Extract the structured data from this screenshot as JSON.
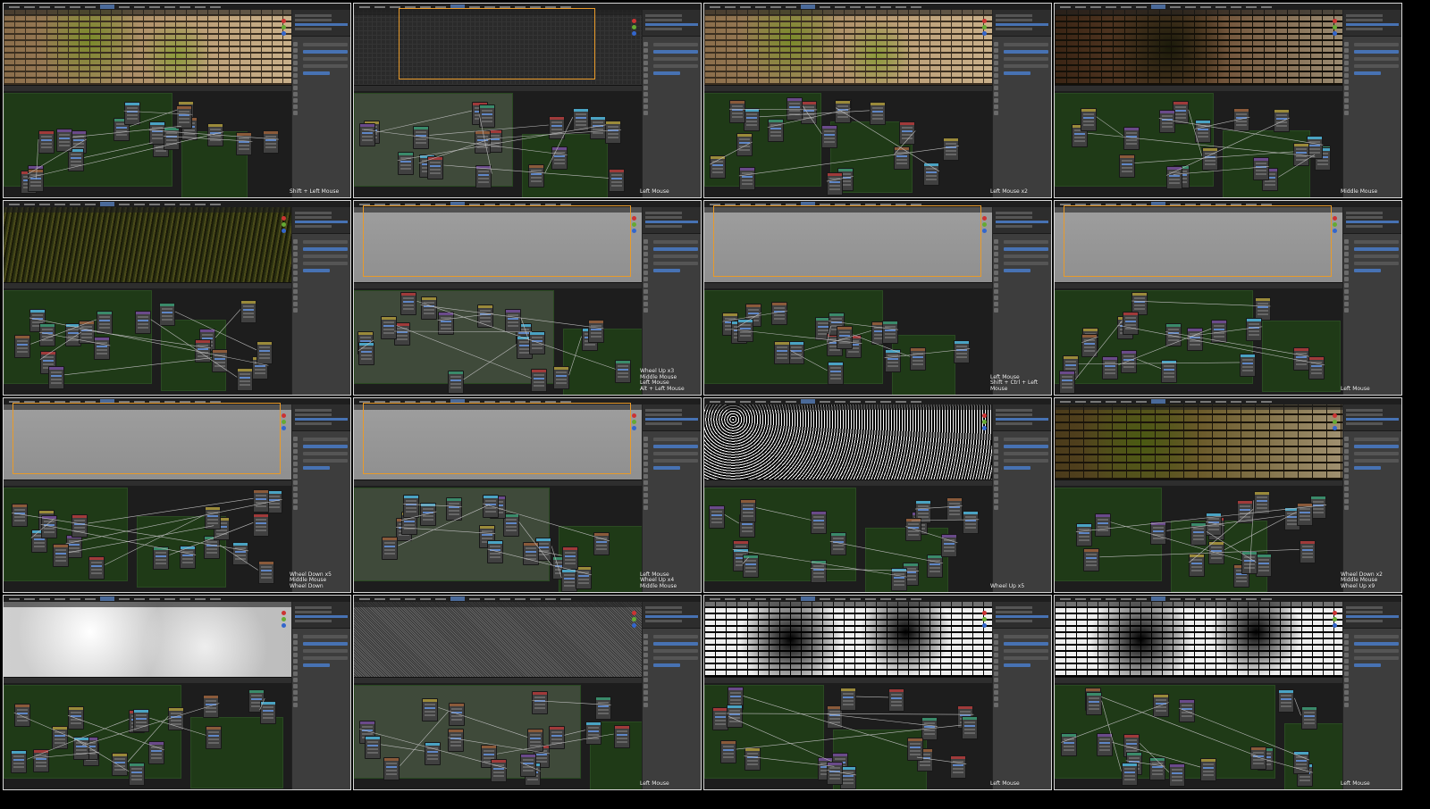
{
  "sheet_title": "Blender Shader Editor session - 16 frame contact sheet",
  "colors": {
    "accent_select": "#4772b3",
    "frame_green": "#1f3a17",
    "outline_orange": "#e89a2a"
  },
  "frames": [
    {
      "viewport": "vp-moss",
      "caption": [
        "Shift + Left Mouse"
      ]
    },
    {
      "viewport": "vp-gridplane",
      "caption": [
        "Left Mouse"
      ]
    },
    {
      "viewport": "vp-moss",
      "caption": [
        "Left Mouse x2"
      ]
    },
    {
      "viewport": "vp-darkbrick",
      "caption": [
        "Middle Mouse"
      ]
    },
    {
      "viewport": "vp-grass",
      "caption": []
    },
    {
      "viewport": "vp-gray",
      "caption": [
        "Wheel Up x3",
        "Middle Mouse",
        "Left Mouse",
        "Alt + Left Mouse"
      ]
    },
    {
      "viewport": "vp-gray",
      "caption": [
        "Left Mouse",
        "Shift + Ctrl + Left Mouse"
      ]
    },
    {
      "viewport": "vp-gray",
      "caption": [
        "Left Mouse"
      ]
    },
    {
      "viewport": "vp-gray",
      "caption": [
        "Wheel Down x5",
        "Middle Mouse",
        "Wheel Down"
      ]
    },
    {
      "viewport": "vp-gray",
      "caption": [
        "Left Mouse",
        "Wheel Up x4",
        "Middle Mouse"
      ]
    },
    {
      "viewport": "vp-noise",
      "caption": [
        "Wheel Up x5"
      ]
    },
    {
      "viewport": "vp-mossbrick",
      "caption": [
        "Wheel Down x2",
        "Middle Mouse",
        "Wheel Up x9"
      ]
    },
    {
      "viewport": "vp-cloud",
      "caption": []
    },
    {
      "viewport": "vp-finenoise",
      "caption": [
        "Left Mouse"
      ]
    },
    {
      "viewport": "vp-bwbrick",
      "caption": [
        "Left Mouse"
      ]
    },
    {
      "viewport": "vp-bwbrick",
      "caption": [
        "Left Mouse"
      ]
    }
  ]
}
